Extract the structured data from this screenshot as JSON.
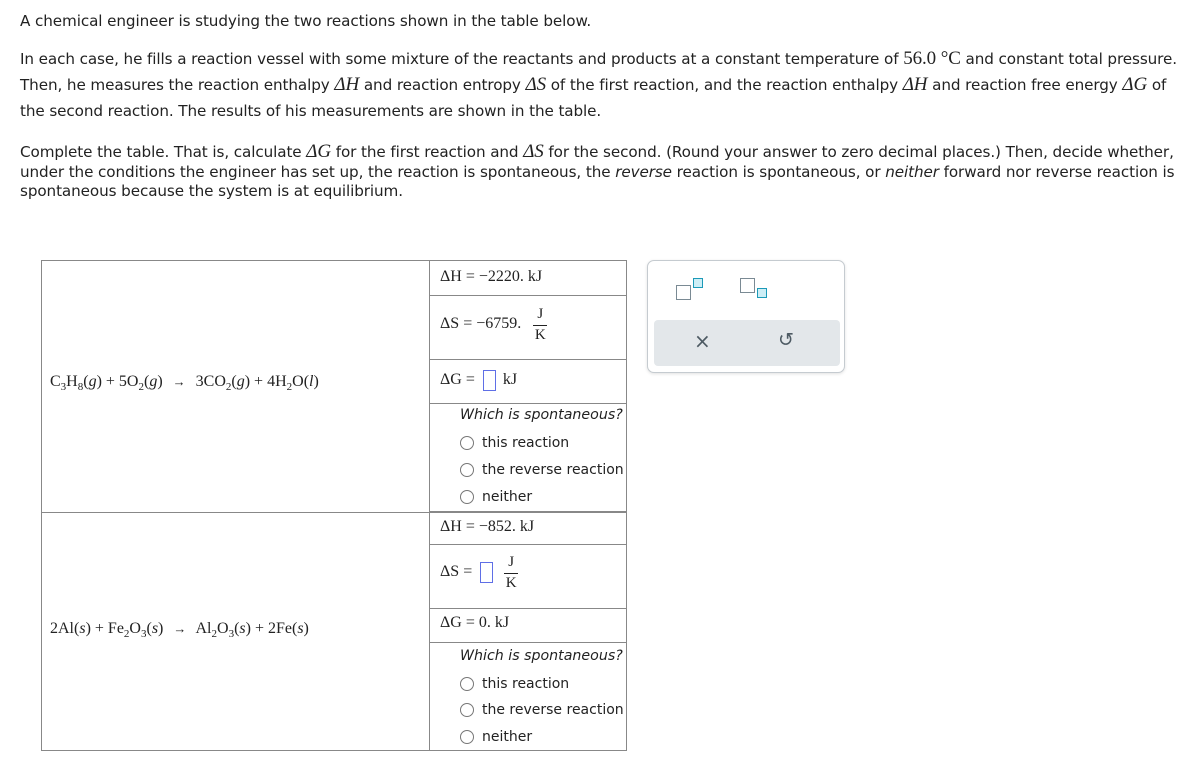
{
  "intro": {
    "line1": "A chemical engineer is studying the two reactions shown in the table below.",
    "p2_a": "In each case, he fills a reaction vessel with some mixture of the reactants and products at a constant temperature of ",
    "temperature": "56.0 °C",
    "p2_b": " and constant total pressure. Then, he measures the reaction enthalpy ",
    "dH": "ΔH",
    "p2_c": " and reaction entropy ",
    "dS": "ΔS",
    "p2_d": " of the first reaction, and the reaction enthalpy ",
    "p2_e": " and reaction free energy ",
    "dG": "ΔG",
    "p2_f": " of the second reaction. The results of his measurements are shown in the table."
  },
  "instructions": {
    "a": "Complete the table. That is, calculate ",
    "b": " for the first reaction and ",
    "c": " for the second. (Round your answer to zero decimal places.) Then, decide whether, under the conditions the engineer has set up, the reaction is spontaneous, the ",
    "reverse": "reverse",
    "d": " reaction is spontaneous, or ",
    "neither": "neither",
    "e": " forward nor reverse reaction is spontaneous because the system is at equilibrium."
  },
  "reactions": [
    {
      "equation": {
        "reactants": [
          {
            "coef": "",
            "formula": [
              "C",
              "3",
              "H",
              "8"
            ],
            "state": "g"
          },
          {
            "coef": "5",
            "formula": [
              "O",
              "2"
            ],
            "state": "g"
          }
        ],
        "products": [
          {
            "coef": "3",
            "formula": [
              "CO",
              "2"
            ],
            "state": "g"
          },
          {
            "coef": "4",
            "formula": [
              "H",
              "2",
              "O"
            ],
            "state": "l"
          }
        ]
      },
      "dH_label": "ΔH",
      "dH_value": "−2220. kJ",
      "dS_label": "ΔS",
      "dS_value": "−6759.",
      "dS_unit_num": "J",
      "dS_unit_den": "K",
      "dG_label": "ΔG",
      "dG_input": "",
      "dG_unit": "kJ",
      "question": "Which is spontaneous?",
      "options": [
        "this reaction",
        "the reverse reaction",
        "neither"
      ]
    },
    {
      "dH_label": "ΔH",
      "dH_value": "−852. kJ",
      "dS_label": "ΔS",
      "dS_input": "",
      "dS_unit_num": "J",
      "dS_unit_den": "K",
      "dG_label": "ΔG",
      "dG_value": "0. kJ",
      "question": "Which is spontaneous?",
      "options": [
        "this reaction",
        "the reverse reaction",
        "neither"
      ]
    }
  ],
  "eq_text": {
    "r1": {
      "c3h8_C": "C",
      "c3h8_3": "3",
      "c3h8_H": "H",
      "c3h8_8": "8",
      "g": "g",
      "plus": "+",
      "five": "5O",
      "two": "2",
      "arrow": "→",
      "three": "3CO",
      "four": "4H",
      "O": "O",
      "l": "l"
    },
    "r2": {
      "twoAl": "2Al",
      "s": "s",
      "plus": "+",
      "Fe": "Fe",
      "two": "2",
      "O": "O",
      "three": "3",
      "arrow": "→",
      "Al": "Al",
      "twoFe": "2Fe"
    }
  },
  "eq": "=",
  "tools": {
    "superscript": "superscript-tool",
    "subscript": "subscript-tool",
    "clear": "×",
    "undo": "↺"
  }
}
